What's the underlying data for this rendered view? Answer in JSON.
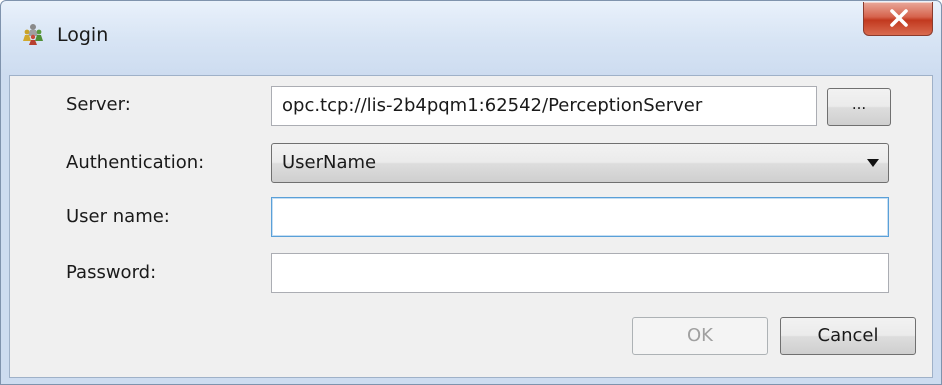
{
  "window": {
    "title": "Login",
    "close_label": "X"
  },
  "form": {
    "server_label": "Server:",
    "server_value": "opc.tcp://lis-2b4pqm1:62542/PerceptionServer",
    "browse_label": "...",
    "auth_label": "Authentication:",
    "auth_selected": "UserName",
    "username_label": "User name:",
    "username_value": "",
    "password_label": "Password:",
    "password_value": ""
  },
  "buttons": {
    "ok_label": "OK",
    "cancel_label": "Cancel"
  },
  "icons": {
    "app": "people-group-icon",
    "close": "close-icon",
    "dropdown": "dropdown-arrow-icon"
  },
  "colors": {
    "close_button": "#c7432a",
    "focus_border": "#5aa0d8",
    "disabled_text": "#a0a0a0"
  }
}
